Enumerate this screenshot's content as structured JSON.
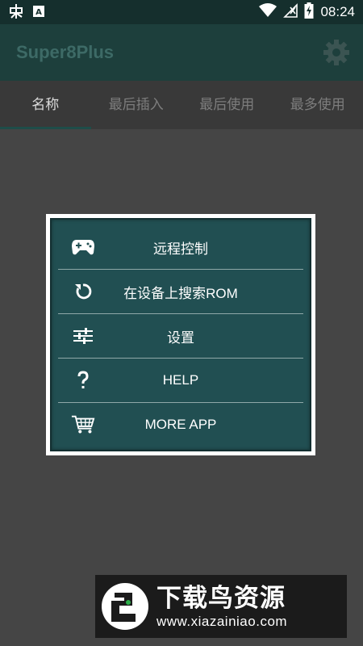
{
  "status_bar": {
    "time": "08:24",
    "left_icons": [
      "debug-bug-icon",
      "app-notification-icon"
    ],
    "right_icons": [
      "wifi-icon",
      "signal-icon",
      "battery-charging-icon"
    ]
  },
  "app_bar": {
    "title": "Super8Plus",
    "settings_icon": "gear-icon"
  },
  "tabs": [
    {
      "label": "名称",
      "active": true
    },
    {
      "label": "最后插入",
      "active": false
    },
    {
      "label": "最后使用",
      "active": false
    },
    {
      "label": "最多使用",
      "active": false
    }
  ],
  "dialog": {
    "items": [
      {
        "label": "远程控制",
        "icon": "gamepad-icon"
      },
      {
        "label": "在设备上搜索ROM",
        "icon": "refresh-icon"
      },
      {
        "label": "设置",
        "icon": "sliders-icon"
      },
      {
        "label": "HELP",
        "icon": "question-icon"
      },
      {
        "label": "MORE APP",
        "icon": "cart-icon"
      }
    ]
  },
  "watermark": {
    "title": "下载鸟资源",
    "url": "www.xiazainiao.com"
  },
  "colors": {
    "status_bar": "#152f2d",
    "app_bar": "#1d3f3c",
    "dialog_bg": "#214f52",
    "overlay_bg": "#454545"
  }
}
